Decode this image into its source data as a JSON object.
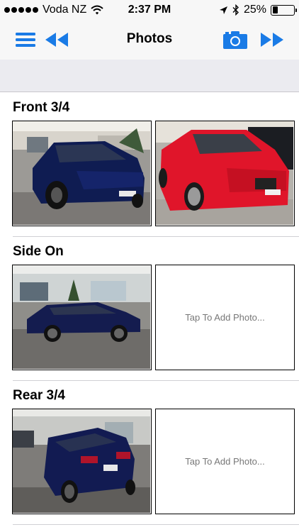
{
  "status_bar": {
    "carrier": "Voda NZ",
    "time": "2:37 PM",
    "battery": "25%",
    "battery_level": 0.25,
    "icons": [
      "signal-dots-icon",
      "wifi-icon",
      "location-arrow-icon",
      "bluetooth-icon",
      "battery-icon"
    ]
  },
  "nav": {
    "title": "Photos",
    "icons": [
      "menu-icon",
      "rewind-icon",
      "camera-icon",
      "fast-forward-icon"
    ]
  },
  "colors": {
    "accent": "#1a7be6",
    "navbar_bg": "#f7f7f7",
    "band_bg": "#ebebf0"
  },
  "sections": [
    {
      "title": "Front 3/4",
      "photos": [
        "photo",
        "photo"
      ]
    },
    {
      "title": "Side On",
      "photos": [
        "photo",
        "placeholder"
      ],
      "placeholder_text": "Tap To Add Photo..."
    },
    {
      "title": "Rear 3/4",
      "photos": [
        "photo",
        "placeholder"
      ],
      "placeholder_text": "Tap To Add Photo..."
    }
  ]
}
